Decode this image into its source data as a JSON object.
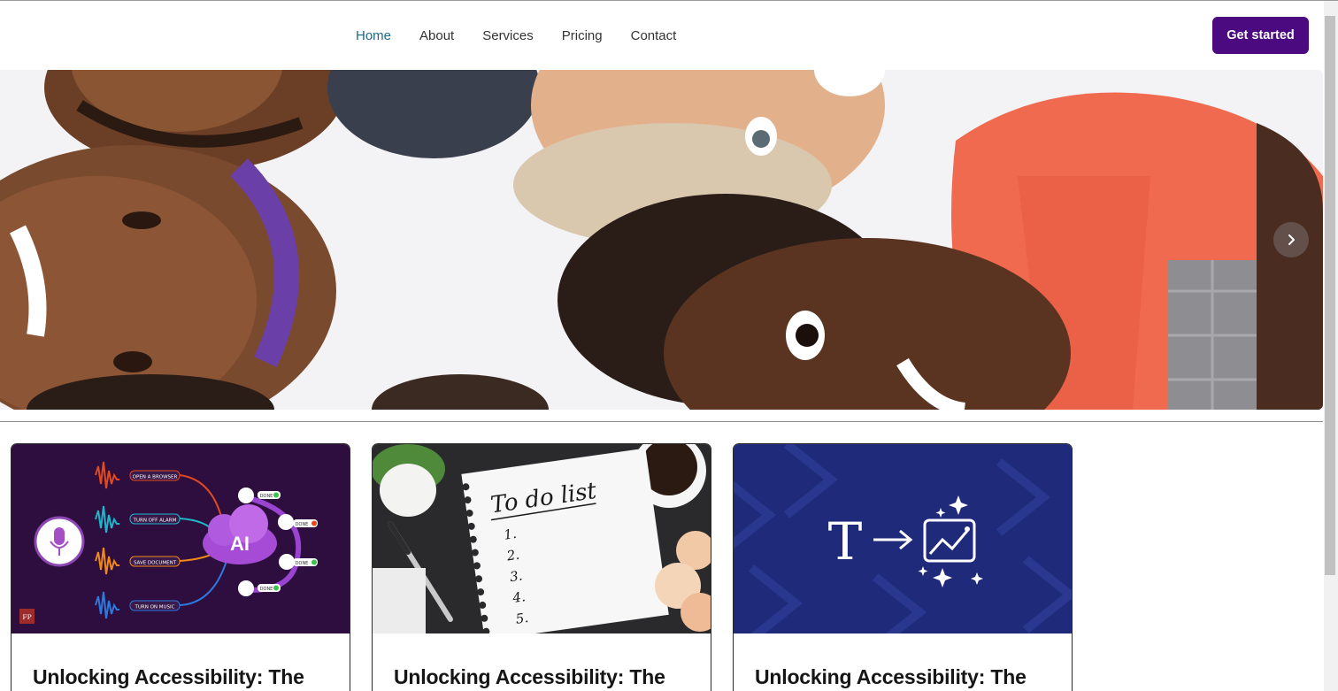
{
  "nav": {
    "links": [
      {
        "label": "Home",
        "active": true
      },
      {
        "label": "About",
        "active": false
      },
      {
        "label": "Services",
        "active": false
      },
      {
        "label": "Pricing",
        "active": false
      },
      {
        "label": "Contact",
        "active": false
      }
    ],
    "cta_label": "Get started"
  },
  "hero": {
    "next_icon": "chevron-right-icon"
  },
  "cards": [
    {
      "title": "Unlocking Accessibility: The",
      "image": {
        "ai_label": "AI",
        "badge": "FP",
        "commands": [
          "OPEN A BROWSER",
          "TURN OFF ALARM",
          "SAVE DOCUMENT",
          "TURN ON MUSIC"
        ],
        "status": [
          "DONE",
          "DONE",
          "DONE",
          "DONE"
        ]
      }
    },
    {
      "title": "Unlocking Accessibility: The",
      "image": {
        "heading": "To do list",
        "items": [
          "1.",
          "2.",
          "3.",
          "4.",
          "5."
        ]
      }
    },
    {
      "title": "Unlocking Accessibility: The",
      "image": {
        "letter": "T"
      }
    }
  ],
  "colors": {
    "cta_bg": "#4b0a7f",
    "nav_active": "#1c6a83",
    "card1_bg": "#2e0e3e",
    "card3_bg": "#1f2a7a"
  }
}
